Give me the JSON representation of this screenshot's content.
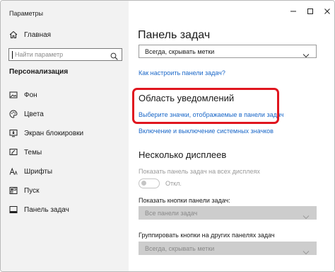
{
  "window": {
    "title": "Параметры"
  },
  "sidebar": {
    "home_label": "Главная",
    "search_placeholder": "Найти параметр",
    "section_title": "Персонализация",
    "items": [
      {
        "label": "Фон",
        "icon": "image-icon"
      },
      {
        "label": "Цвета",
        "icon": "palette-icon"
      },
      {
        "label": "Экран блокировки",
        "icon": "lock-screen-icon"
      },
      {
        "label": "Темы",
        "icon": "brush-icon"
      },
      {
        "label": "Шрифты",
        "icon": "font-icon"
      },
      {
        "label": "Пуск",
        "icon": "start-icon"
      },
      {
        "label": "Панель задач",
        "icon": "taskbar-icon"
      }
    ]
  },
  "main": {
    "title": "Панель задач",
    "combo_top_value": "Всегда, скрывать метки",
    "link_customize": "Как настроить панели задач?",
    "notif_heading": "Область уведомлений",
    "link_select_icons": "Выберите значки, отображаемые в панели задач",
    "link_system_icons": "Включение и выключение системных значков",
    "multi_heading": "Несколько дисплеев",
    "show_all_displays_label": "Показать панель задач на всех дисплеях",
    "toggle_state": "Откл.",
    "show_buttons_label": "Показать кнопки панели задач:",
    "show_buttons_value": "Все панели задач",
    "group_label": "Группировать кнопки на других панелях задач",
    "group_value": "Всегда, скрывать метки"
  },
  "colors": {
    "accent_link": "#1a67c8",
    "highlight": "#e0161f",
    "disabled_fill": "#cdcdcd"
  }
}
